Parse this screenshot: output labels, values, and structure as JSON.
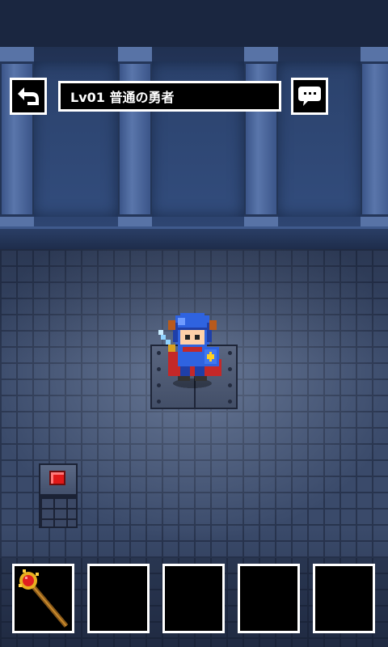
{
  "header": {
    "level_title": "Lv01 普通の勇者",
    "back_icon": "return-arrow-icon",
    "hint_icon": "speech-bubble-icon"
  },
  "scene": {
    "hero": "knight-hero-sprite",
    "floor_plate": "pressure-plate",
    "switch": "red-button-pedestal"
  },
  "inventory": {
    "slots": [
      {
        "item": "magic-staff-icon",
        "filled": true
      },
      {
        "item": "",
        "filled": false
      },
      {
        "item": "",
        "filled": false
      },
      {
        "item": "",
        "filled": false
      },
      {
        "item": "",
        "filled": false
      }
    ]
  },
  "colors": {
    "hud_bg": "#000000",
    "hud_border": "#ffffff",
    "switch_red": "#e01818",
    "hero_blue": "#2f63e0"
  }
}
